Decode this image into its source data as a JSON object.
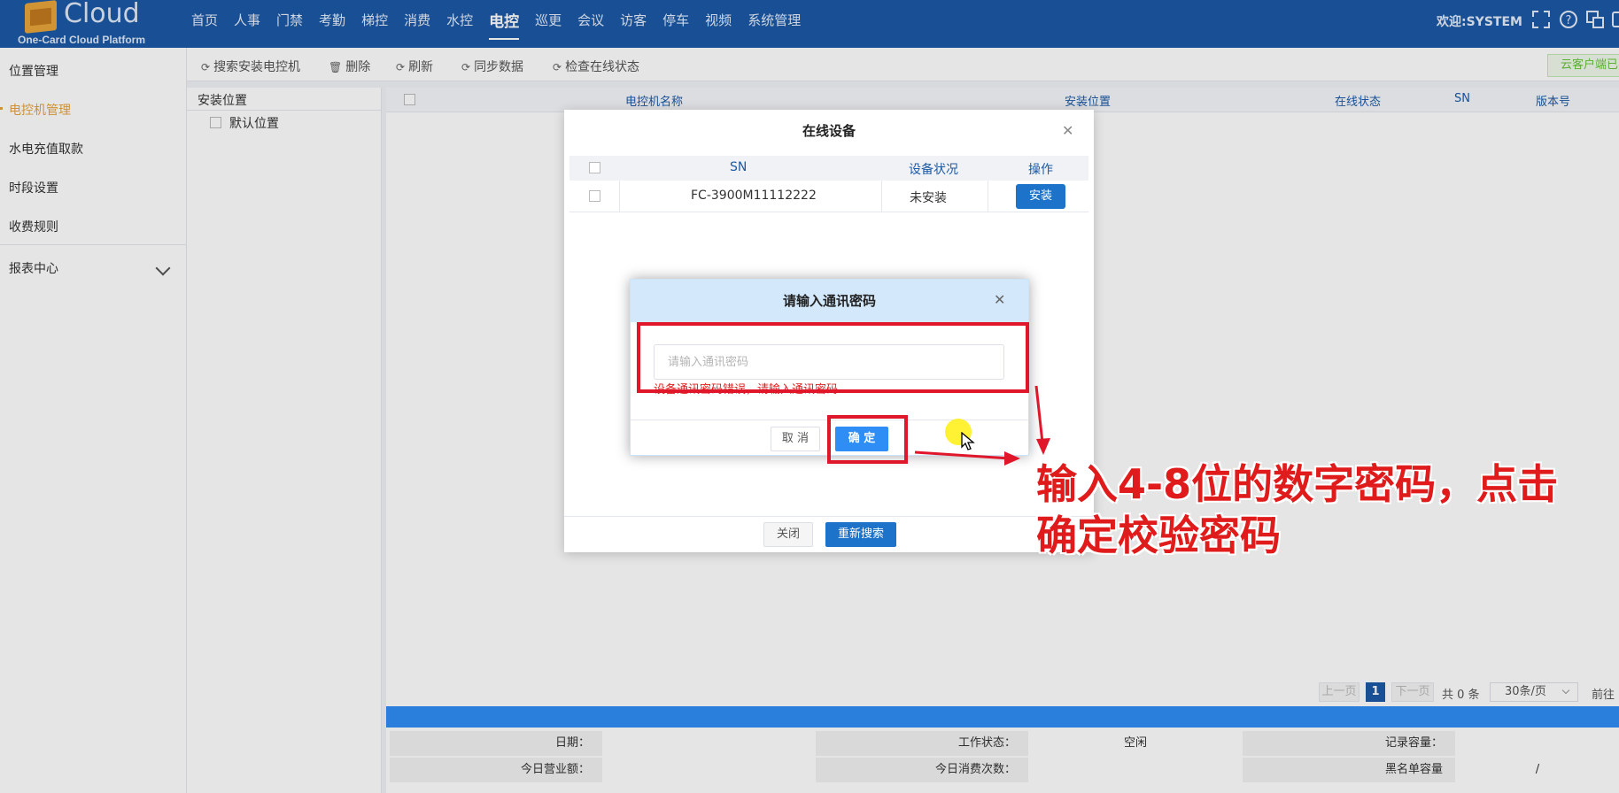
{
  "brand": {
    "name": "Cloud",
    "sub": "One-Card Cloud Platform"
  },
  "nav": [
    {
      "label": "首页"
    },
    {
      "label": "人事"
    },
    {
      "label": "门禁"
    },
    {
      "label": "考勤"
    },
    {
      "label": "梯控"
    },
    {
      "label": "消费"
    },
    {
      "label": "水控"
    },
    {
      "label": "电控",
      "active": true
    },
    {
      "label": "巡更"
    },
    {
      "label": "会议"
    },
    {
      "label": "访客"
    },
    {
      "label": "停车"
    },
    {
      "label": "视频"
    },
    {
      "label": "系统管理"
    }
  ],
  "header": {
    "welcome": "欢迎:SYSTEM"
  },
  "sidebar": {
    "items": [
      {
        "label": "位置管理"
      },
      {
        "label": "电控机管理",
        "active": true
      },
      {
        "label": "水电充值取款"
      },
      {
        "label": "时段设置"
      },
      {
        "label": "收费规则"
      },
      {
        "label": "报表中心"
      }
    ]
  },
  "toolbar": {
    "buttons": [
      "搜索安装电控机",
      "删除",
      "刷新",
      "同步数据",
      "检查在线状态"
    ],
    "cloud": "云客户端已"
  },
  "tree": {
    "header": "安装位置",
    "node": "默认位置"
  },
  "table": {
    "columns": [
      "电控机名称",
      "安装位置",
      "在线状态",
      "SN",
      "版本号"
    ]
  },
  "pager": {
    "prev": "上一页",
    "page": "1",
    "next": "下一页",
    "total": "共 0 条",
    "size": "30条/页",
    "goto": "前往"
  },
  "info": {
    "date_label": "日期：",
    "date_value": "",
    "work_label": "工作状态：",
    "work_value": "空闲",
    "capacity_label": "记录容量：",
    "capacity_value": "",
    "revenue_label": "今日营业额：",
    "revenue_value": "",
    "count_label": "今日消费次数：",
    "count_value": "",
    "blacklist_label": "黑名单容量",
    "blacklist_value": "/"
  },
  "online_dialog": {
    "title": "在线设备",
    "columns": [
      "SN",
      "设备状况",
      "操作"
    ],
    "rows": [
      {
        "sn": "FC-3900M11112222",
        "status": "未安装",
        "action": "安装"
      }
    ],
    "close": "关闭",
    "research": "重新搜索"
  },
  "password_dialog": {
    "title": "请输入通讯密码",
    "placeholder": "请输入通讯密码",
    "value": "",
    "error": "设备通讯密码错误，请输入通讯密码",
    "cancel": "取 消",
    "ok": "确 定"
  },
  "annotation": {
    "line1": "输入4-8位的数字密码，点击",
    "line2": "确定校验密码"
  },
  "colors": {
    "topbar": "#1c5aa6",
    "accent": "#2f8ef5",
    "highlight": "#e0162b",
    "active_menu": "#e6a23c"
  }
}
